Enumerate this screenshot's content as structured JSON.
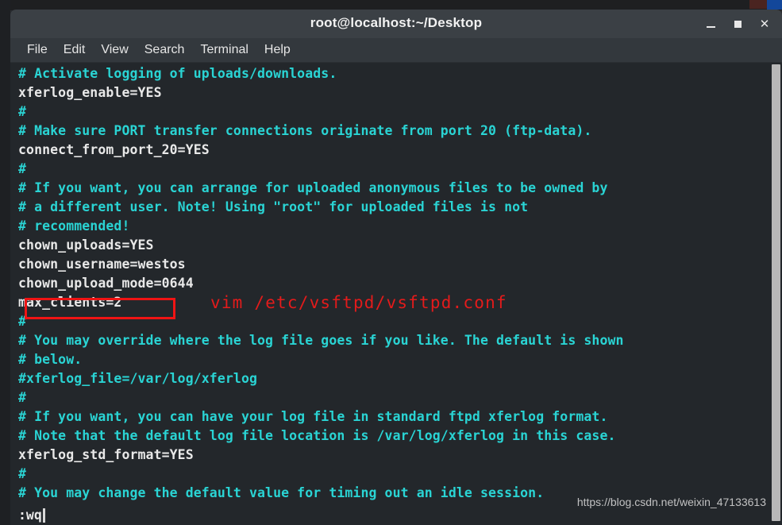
{
  "window": {
    "title": "root@localhost:~/Desktop",
    "controls": [
      {
        "name": "minimize-button",
        "label": "_"
      },
      {
        "name": "maximize-button",
        "label": "□"
      },
      {
        "name": "close-button",
        "label": "✕"
      }
    ]
  },
  "menubar": {
    "items": [
      {
        "label": "File"
      },
      {
        "label": "Edit"
      },
      {
        "label": "View"
      },
      {
        "label": "Search"
      },
      {
        "label": "Terminal"
      },
      {
        "label": "Help"
      }
    ]
  },
  "terminal": {
    "lines": [
      {
        "text": "# Activate logging of uploads/downloads.",
        "kind": "comment"
      },
      {
        "text": "xferlog_enable=YES",
        "kind": "code"
      },
      {
        "text": "#",
        "kind": "comment"
      },
      {
        "text": "# Make sure PORT transfer connections originate from port 20 (ftp-data).",
        "kind": "comment"
      },
      {
        "text": "connect_from_port_20=YES",
        "kind": "code"
      },
      {
        "text": "#",
        "kind": "comment"
      },
      {
        "text": "# If you want, you can arrange for uploaded anonymous files to be owned by",
        "kind": "comment"
      },
      {
        "text": "# a different user. Note! Using \"root\" for uploaded files is not",
        "kind": "comment"
      },
      {
        "text": "# recommended!",
        "kind": "comment"
      },
      {
        "text": "chown_uploads=YES",
        "kind": "code"
      },
      {
        "text": "chown_username=westos",
        "kind": "code"
      },
      {
        "text": "chown_upload_mode=0644",
        "kind": "code"
      }
    ],
    "highlighted_line": {
      "text": "max_clients=2",
      "kind": "code"
    },
    "lines_after": [
      {
        "text": "#",
        "kind": "comment"
      },
      {
        "text": "# You may override where the log file goes if you like. The default is shown",
        "kind": "comment"
      },
      {
        "text": "# below.",
        "kind": "comment"
      },
      {
        "text": "#xferlog_file=/var/log/xferlog",
        "kind": "comment"
      },
      {
        "text": "#",
        "kind": "comment"
      },
      {
        "text": "# If you want, you can have your log file in standard ftpd xferlog format.",
        "kind": "comment"
      },
      {
        "text": "# Note that the default log file location is /var/log/xferlog in this case.",
        "kind": "comment"
      },
      {
        "text": "xferlog_std_format=YES",
        "kind": "code"
      },
      {
        "text": "#",
        "kind": "comment"
      },
      {
        "text": "# You may change the default value for timing out an idle session.",
        "kind": "comment"
      }
    ],
    "status_line": ":wq"
  },
  "annotation": {
    "command": "vim /etc/vsftpd/vsftpd.conf",
    "box_color": "#f01414",
    "text_color": "#e31b1b"
  },
  "watermark": {
    "text": "https://blog.csdn.net/weixin_47133613"
  },
  "colors": {
    "terminal_bg": "#23272b",
    "titlebar_bg": "#3b4045",
    "menubar_bg": "#33383d",
    "comment": "#2ad4d4",
    "code": "#e8e8e8"
  }
}
